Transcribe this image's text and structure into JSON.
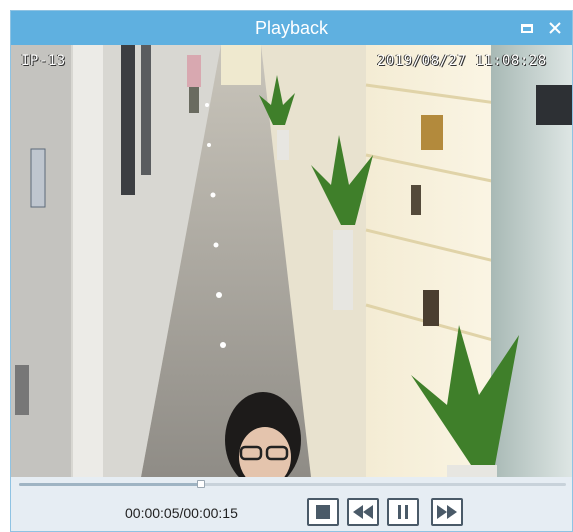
{
  "window": {
    "title": "Playback"
  },
  "titlebar_icons": {
    "maximize": "maximize-icon",
    "close": "close-icon"
  },
  "video": {
    "camera_label": "IP-13",
    "timestamp": "2019/08/27 11:08:28"
  },
  "playback": {
    "position_fraction": 0.333,
    "time_text": "00:00:05/00:00:15"
  },
  "controls": {
    "stop": "stop-icon",
    "rewind": "rewind-icon",
    "pause": "pause-icon",
    "fast_forward": "fast-forward-icon"
  },
  "colors": {
    "titlebar": "#5fb0e0",
    "control_panel": "#e6edf3",
    "button_border": "#4a5a68"
  }
}
